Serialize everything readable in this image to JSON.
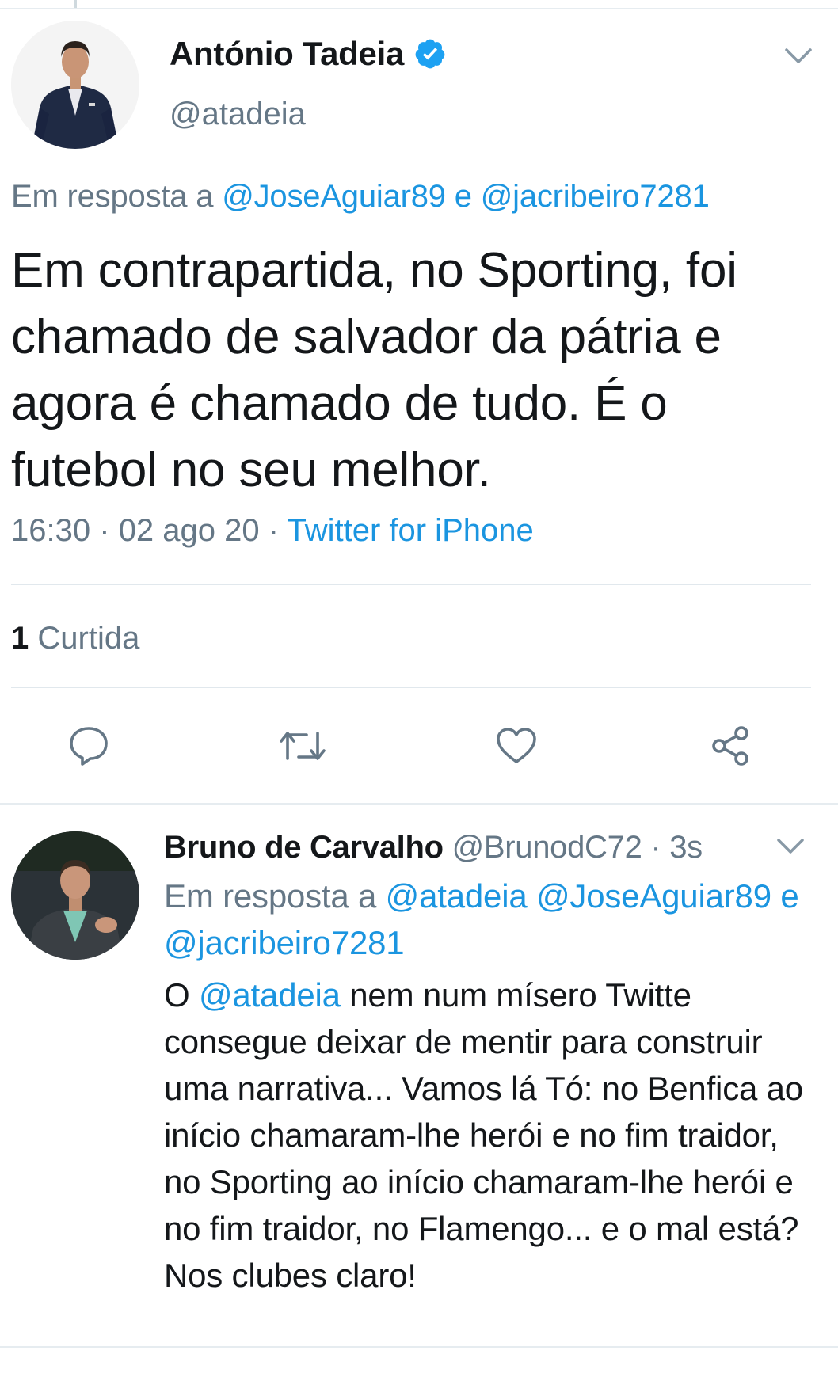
{
  "main_tweet": {
    "author_name": "António Tadeia",
    "handle": "@atadeia",
    "reply_prefix": "Em resposta a",
    "reply_user_1": "@JoseAguiar89",
    "reply_conj": "e",
    "reply_user_2": "@jacribeiro7281",
    "text": "Em contrapartida, no Sporting, foi chamado de salvador da pátria e agora é chamado de tudo. É o futebol no seu melhor.",
    "time": "16:30",
    "date": "02 ago 20",
    "source": "Twitter for iPhone",
    "separator": "·",
    "likes_count": "1",
    "likes_label": "Curtida",
    "icons": {
      "verified": "verified-badge-icon",
      "caret": "chevron-down-icon",
      "reply": "reply-icon",
      "retweet": "retweet-icon",
      "like": "heart-icon",
      "share": "share-icon"
    }
  },
  "reply_tweet": {
    "author_name": "Bruno de Carvalho",
    "handle": "@BrunodC72",
    "separator": "·",
    "time_ago": "3s",
    "reply_prefix": "Em resposta a",
    "reply_user_1": "@atadeia",
    "reply_user_2": "@JoseAguiar89",
    "reply_conj": "e",
    "reply_user_3": "@jacribeiro7281",
    "text_prefix": "O",
    "mention": "@atadeia",
    "text_rest": " nem num mísero Twitte consegue deixar de mentir para construir uma narrativa... Vamos lá Tó: no Benfica ao início chamaram-lhe herói e no fim traidor, no Sporting ao início chamaram-lhe herói e no fim traidor, no Flamengo... e o  mal está? Nos clubes claro!"
  },
  "colors": {
    "link": "#1b95e0",
    "secondary_text": "#657786",
    "primary_text": "#14171a",
    "verified": "#1da1f2",
    "divider": "#e1e8ed"
  }
}
